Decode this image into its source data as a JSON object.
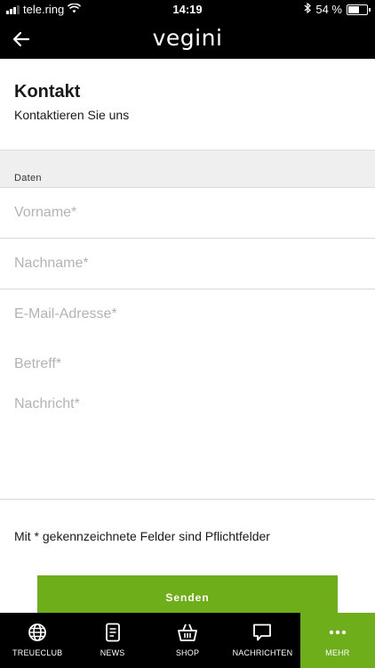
{
  "status_bar": {
    "carrier": "tele.ring",
    "time": "14:19",
    "battery": "54 %"
  },
  "header": {
    "logo_text": "vegini",
    "accent_color": "#6fae1b"
  },
  "page": {
    "title": "Kontakt",
    "subtitle": "Kontaktieren Sie uns"
  },
  "form": {
    "section_label": "Daten",
    "fields": [
      {
        "placeholder": "Vorname*",
        "value": ""
      },
      {
        "placeholder": "Nachname*",
        "value": ""
      },
      {
        "placeholder": "E-Mail-Adresse*",
        "value": ""
      },
      {
        "placeholder": "Betreff*",
        "value": ""
      },
      {
        "placeholder": "Nachricht*",
        "value": ""
      }
    ],
    "required_note": "Mit * gekennzeichnete Felder sind Pflichtfelder",
    "send_label": "Senden"
  },
  "tab_bar": {
    "tabs": [
      {
        "label": "TREUECLUB",
        "icon": "globe-icon"
      },
      {
        "label": "NEWS",
        "icon": "document-icon"
      },
      {
        "label": "SHOP",
        "icon": "basket-icon"
      },
      {
        "label": "NACHRICHTEN",
        "icon": "chat-bubble-icon"
      },
      {
        "label": "MEHR",
        "icon": "more-dots-icon",
        "active": true
      }
    ]
  }
}
